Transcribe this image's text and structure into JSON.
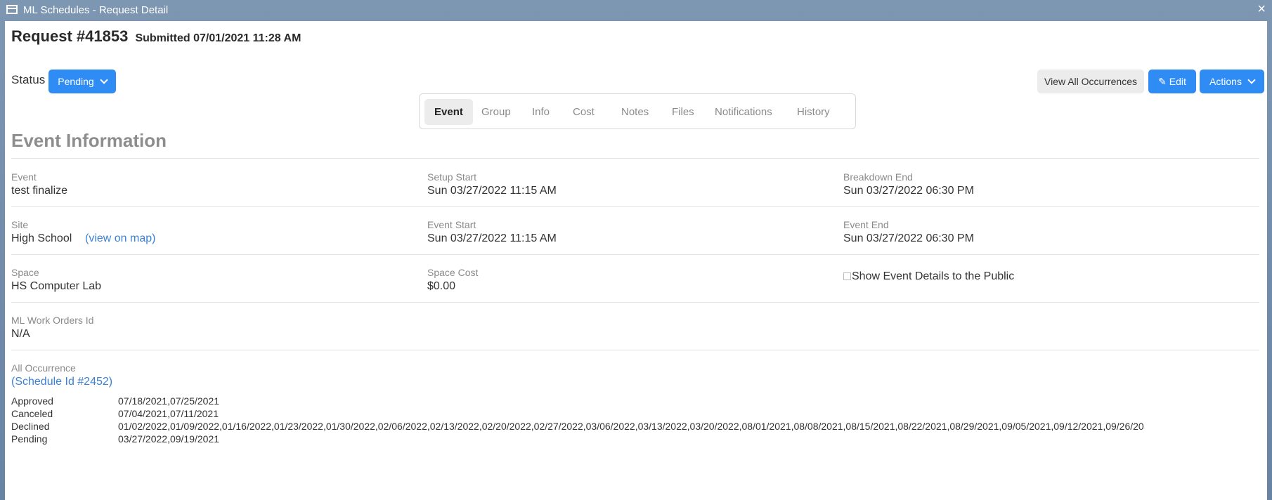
{
  "window": {
    "title": "ML Schedules - Request Detail",
    "close_glyph": "×"
  },
  "header": {
    "request_label": "Request #41853",
    "submitted_label": "Submitted 07/01/2021 11:28 AM"
  },
  "status": {
    "label": "Status",
    "value": "Pending"
  },
  "toolbar": {
    "view_all": "View All Occurrences",
    "edit": "Edit",
    "actions": "Actions"
  },
  "tabs": [
    "Event",
    "Group",
    "Info",
    "Cost",
    "Notes",
    "Files",
    "Notifications",
    "History"
  ],
  "active_tab": "Event",
  "section_title": "Event Information",
  "fields": {
    "event": {
      "label": "Event",
      "value": "test finalize"
    },
    "setup_start": {
      "label": "Setup Start",
      "value": "Sun 03/27/2022 11:15 AM"
    },
    "breakdown_end": {
      "label": "Breakdown End",
      "value": "Sun 03/27/2022 06:30 PM"
    },
    "site": {
      "label": "Site",
      "value": "High School",
      "link": "(view on map)"
    },
    "event_start": {
      "label": "Event Start",
      "value": "Sun 03/27/2022 11:15 AM"
    },
    "event_end": {
      "label": "Event End",
      "value": "Sun 03/27/2022 06:30 PM"
    },
    "space": {
      "label": "Space",
      "value": "HS Computer Lab"
    },
    "space_cost": {
      "label": "Space Cost",
      "value": "$0.00"
    },
    "show_public": {
      "label": "Show Event Details to the Public",
      "checked": false
    },
    "work_orders": {
      "label": "ML Work Orders Id",
      "value": "N/A"
    }
  },
  "occurrence": {
    "label": "All Occurrence",
    "schedule_link": "(Schedule Id #2452)",
    "rows": [
      {
        "k": "Approved",
        "v": "07/18/2021,07/25/2021"
      },
      {
        "k": "Canceled",
        "v": "07/04/2021,07/11/2021"
      },
      {
        "k": "Declined",
        "v": "01/02/2022,01/09/2022,01/16/2022,01/23/2022,01/30/2022,02/06/2022,02/13/2022,02/20/2022,02/27/2022,03/06/2022,03/13/2022,03/20/2022,08/01/2021,08/08/2021,08/15/2021,08/22/2021,08/29/2021,09/05/2021,09/12/2021,09/26/20"
      },
      {
        "k": "Pending",
        "v": "03/27/2022,09/19/2021"
      }
    ]
  }
}
